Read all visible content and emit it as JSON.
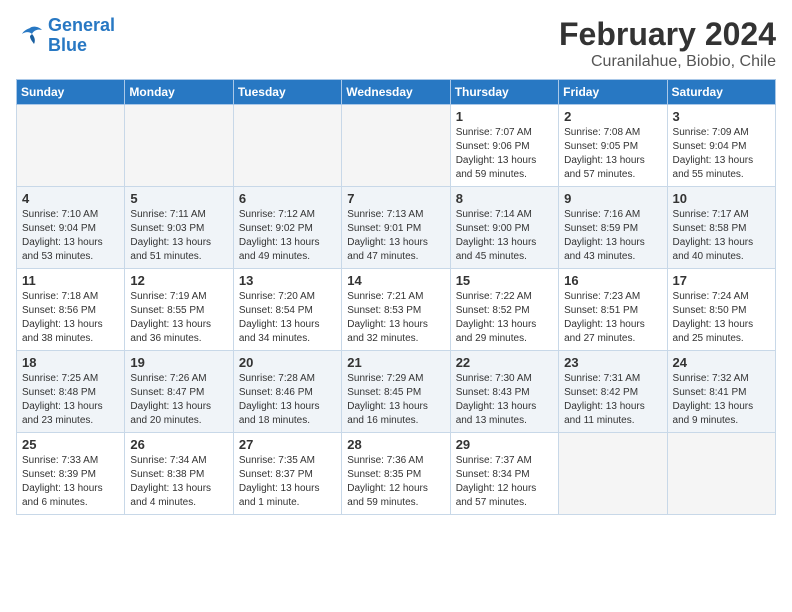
{
  "header": {
    "logo_line1": "General",
    "logo_line2": "Blue",
    "title": "February 2024",
    "subtitle": "Curanilahue, Biobio, Chile"
  },
  "days_of_week": [
    "Sunday",
    "Monday",
    "Tuesday",
    "Wednesday",
    "Thursday",
    "Friday",
    "Saturday"
  ],
  "weeks": [
    [
      {
        "day": "",
        "content": ""
      },
      {
        "day": "",
        "content": ""
      },
      {
        "day": "",
        "content": ""
      },
      {
        "day": "",
        "content": ""
      },
      {
        "day": "1",
        "content": "Sunrise: 7:07 AM\nSunset: 9:06 PM\nDaylight: 13 hours\nand 59 minutes."
      },
      {
        "day": "2",
        "content": "Sunrise: 7:08 AM\nSunset: 9:05 PM\nDaylight: 13 hours\nand 57 minutes."
      },
      {
        "day": "3",
        "content": "Sunrise: 7:09 AM\nSunset: 9:04 PM\nDaylight: 13 hours\nand 55 minutes."
      }
    ],
    [
      {
        "day": "4",
        "content": "Sunrise: 7:10 AM\nSunset: 9:04 PM\nDaylight: 13 hours\nand 53 minutes."
      },
      {
        "day": "5",
        "content": "Sunrise: 7:11 AM\nSunset: 9:03 PM\nDaylight: 13 hours\nand 51 minutes."
      },
      {
        "day": "6",
        "content": "Sunrise: 7:12 AM\nSunset: 9:02 PM\nDaylight: 13 hours\nand 49 minutes."
      },
      {
        "day": "7",
        "content": "Sunrise: 7:13 AM\nSunset: 9:01 PM\nDaylight: 13 hours\nand 47 minutes."
      },
      {
        "day": "8",
        "content": "Sunrise: 7:14 AM\nSunset: 9:00 PM\nDaylight: 13 hours\nand 45 minutes."
      },
      {
        "day": "9",
        "content": "Sunrise: 7:16 AM\nSunset: 8:59 PM\nDaylight: 13 hours\nand 43 minutes."
      },
      {
        "day": "10",
        "content": "Sunrise: 7:17 AM\nSunset: 8:58 PM\nDaylight: 13 hours\nand 40 minutes."
      }
    ],
    [
      {
        "day": "11",
        "content": "Sunrise: 7:18 AM\nSunset: 8:56 PM\nDaylight: 13 hours\nand 38 minutes."
      },
      {
        "day": "12",
        "content": "Sunrise: 7:19 AM\nSunset: 8:55 PM\nDaylight: 13 hours\nand 36 minutes."
      },
      {
        "day": "13",
        "content": "Sunrise: 7:20 AM\nSunset: 8:54 PM\nDaylight: 13 hours\nand 34 minutes."
      },
      {
        "day": "14",
        "content": "Sunrise: 7:21 AM\nSunset: 8:53 PM\nDaylight: 13 hours\nand 32 minutes."
      },
      {
        "day": "15",
        "content": "Sunrise: 7:22 AM\nSunset: 8:52 PM\nDaylight: 13 hours\nand 29 minutes."
      },
      {
        "day": "16",
        "content": "Sunrise: 7:23 AM\nSunset: 8:51 PM\nDaylight: 13 hours\nand 27 minutes."
      },
      {
        "day": "17",
        "content": "Sunrise: 7:24 AM\nSunset: 8:50 PM\nDaylight: 13 hours\nand 25 minutes."
      }
    ],
    [
      {
        "day": "18",
        "content": "Sunrise: 7:25 AM\nSunset: 8:48 PM\nDaylight: 13 hours\nand 23 minutes."
      },
      {
        "day": "19",
        "content": "Sunrise: 7:26 AM\nSunset: 8:47 PM\nDaylight: 13 hours\nand 20 minutes."
      },
      {
        "day": "20",
        "content": "Sunrise: 7:28 AM\nSunset: 8:46 PM\nDaylight: 13 hours\nand 18 minutes."
      },
      {
        "day": "21",
        "content": "Sunrise: 7:29 AM\nSunset: 8:45 PM\nDaylight: 13 hours\nand 16 minutes."
      },
      {
        "day": "22",
        "content": "Sunrise: 7:30 AM\nSunset: 8:43 PM\nDaylight: 13 hours\nand 13 minutes."
      },
      {
        "day": "23",
        "content": "Sunrise: 7:31 AM\nSunset: 8:42 PM\nDaylight: 13 hours\nand 11 minutes."
      },
      {
        "day": "24",
        "content": "Sunrise: 7:32 AM\nSunset: 8:41 PM\nDaylight: 13 hours\nand 9 minutes."
      }
    ],
    [
      {
        "day": "25",
        "content": "Sunrise: 7:33 AM\nSunset: 8:39 PM\nDaylight: 13 hours\nand 6 minutes."
      },
      {
        "day": "26",
        "content": "Sunrise: 7:34 AM\nSunset: 8:38 PM\nDaylight: 13 hours\nand 4 minutes."
      },
      {
        "day": "27",
        "content": "Sunrise: 7:35 AM\nSunset: 8:37 PM\nDaylight: 13 hours\nand 1 minute."
      },
      {
        "day": "28",
        "content": "Sunrise: 7:36 AM\nSunset: 8:35 PM\nDaylight: 12 hours\nand 59 minutes."
      },
      {
        "day": "29",
        "content": "Sunrise: 7:37 AM\nSunset: 8:34 PM\nDaylight: 12 hours\nand 57 minutes."
      },
      {
        "day": "",
        "content": ""
      },
      {
        "day": "",
        "content": ""
      }
    ]
  ]
}
